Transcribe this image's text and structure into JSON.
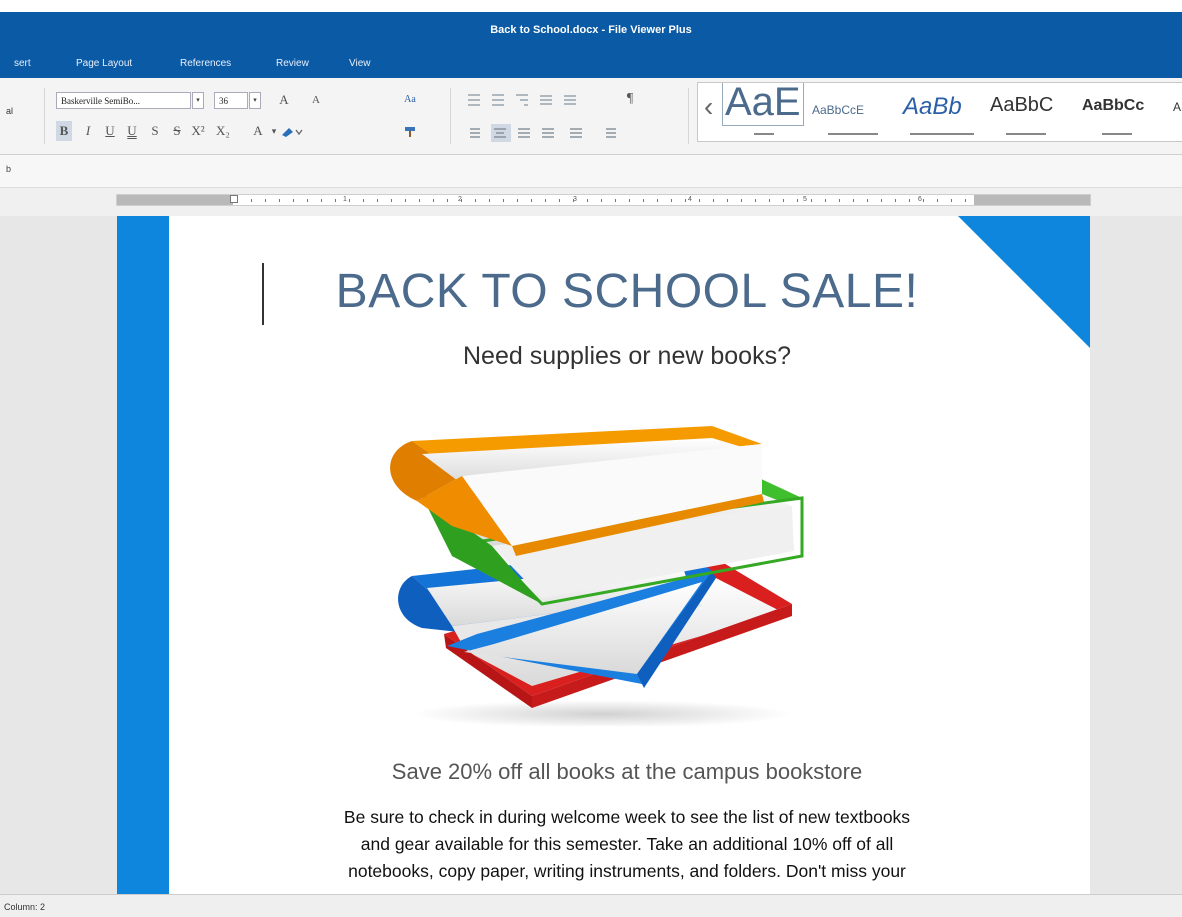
{
  "window": {
    "title": "Back to School.docx - File Viewer Plus"
  },
  "tabs": [
    "sert",
    "Page Layout",
    "References",
    "Review",
    "View"
  ],
  "ribbon": {
    "left_edge": "al",
    "font_name": "Baskerville SemiBo...",
    "font_size": "36",
    "grow_font": "A",
    "shrink_font": "A",
    "change_case": "Aa",
    "bold": "B",
    "italic": "I",
    "underline": "U",
    "double_underline": "U",
    "strikethrough": "S",
    "strike2": "S",
    "superscript": "X²",
    "subscript": "X₂",
    "font_color": "A",
    "pilcrow": "¶",
    "styles": [
      "AaE",
      "AaBbCcE",
      "AaBb",
      "AaBbC",
      "AaBbCc",
      "A"
    ]
  },
  "bar2": {
    "label": "b"
  },
  "ruler": {
    "numbers": [
      "1",
      "2",
      "3",
      "4",
      "5",
      "6"
    ]
  },
  "document": {
    "title": "BACK TO SCHOOL SALE!",
    "subtitle": "Need supplies or new books?",
    "save_line": "Save 20% off all books at the campus bookstore",
    "body_lines": [
      "Be sure to check in during welcome week to see the list of new textbooks",
      "and gear available for this semester.  Take an additional 10% off of all",
      "notebooks, copy paper, writing instruments, and folders.  Don't miss your"
    ]
  },
  "status": {
    "text": "Column: 2"
  },
  "colors": {
    "titlebar": "#0b5aa6",
    "accent": "#0e86de",
    "title_text": "#4b6a8c"
  },
  "icons": [
    "book-stack-image"
  ]
}
